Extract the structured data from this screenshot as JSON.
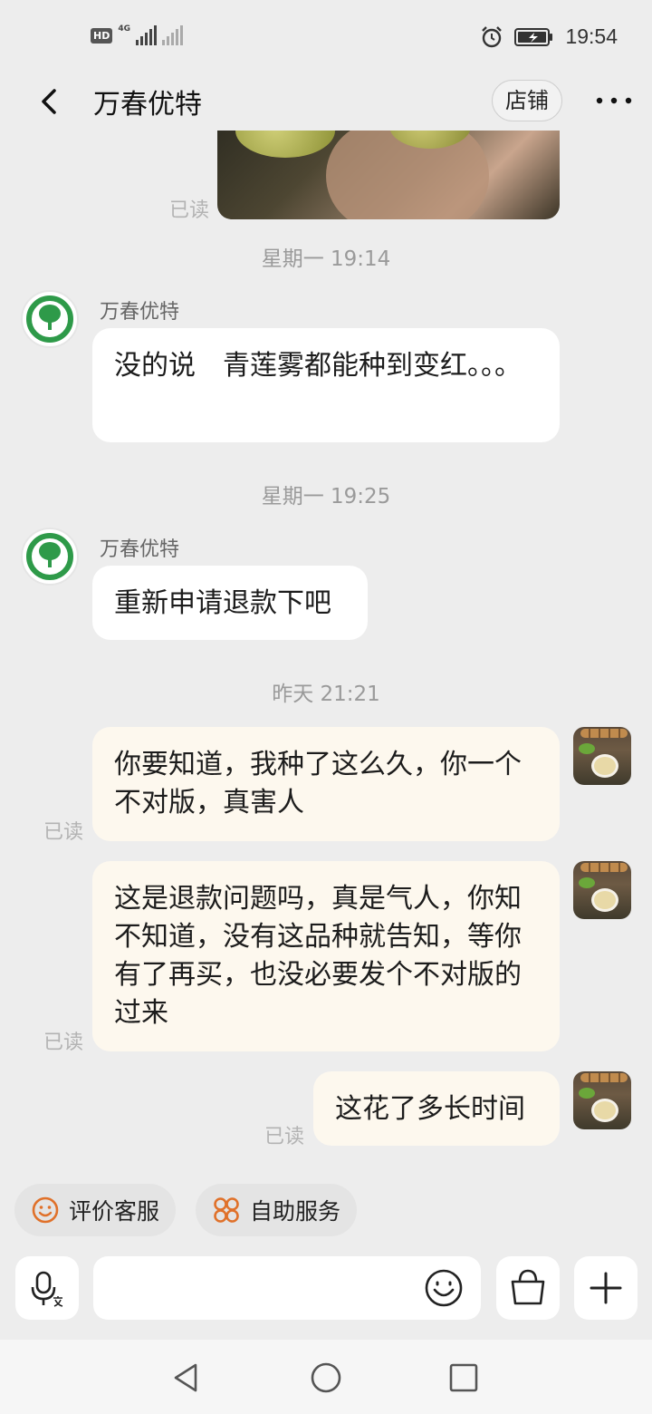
{
  "status_bar": {
    "left_tag": "HD",
    "network": "4G",
    "time": "19:54"
  },
  "header": {
    "title": "万春优特",
    "shop_label": "店铺"
  },
  "messages": {
    "read_label": "已读",
    "ts1": "星期一 19:14",
    "ts2": "星期一 19:25",
    "ts3": "昨天  21:21",
    "sender_name": "万春优特",
    "in1": "没的说　青莲雾都能种到变红。。。",
    "in2": "重新申请退款下吧",
    "out1": "你要知道，我种了这么久，你一个不对版，真害人",
    "out2": "这是退款问题吗，真是气人，你知不知道，没有这品种就告知，等你有了再买，也没必要发个不对版的过来",
    "out3": "这花了多长时间"
  },
  "quick_actions": {
    "rate_label": "评价客服",
    "self_service_label": "自助服务"
  },
  "input": {
    "placeholder": ""
  },
  "icons": [
    "back-icon",
    "more-icon",
    "smile-icon",
    "grid-icon",
    "voice-icon",
    "emoji-icon",
    "bag-icon",
    "plus-icon",
    "nav-back-icon",
    "nav-home-icon",
    "nav-recents-icon",
    "alarm-icon",
    "battery-icon"
  ],
  "colors": {
    "background": "#ededed",
    "incoming_bubble": "#ffffff",
    "outgoing_bubble": "#fdf8ee",
    "accent_orange": "#e0712a",
    "logo_green": "#2e9a49"
  }
}
